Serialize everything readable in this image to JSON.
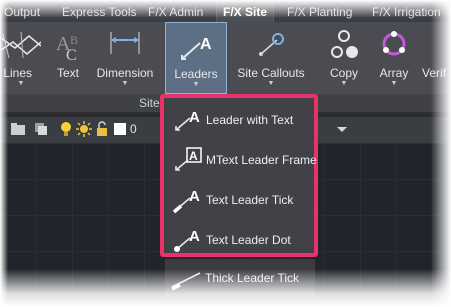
{
  "tabs": [
    "Output",
    "Express Tools",
    "F/X Admin",
    "F/X Site",
    "F/X Planting",
    "F/X Irrigation"
  ],
  "active_tab": "F/X Site",
  "ribbon_buttons": {
    "lines": "Lines",
    "text": "Text",
    "dimension": "Dimension",
    "leaders": "Leaders",
    "site_callouts": "Site Callouts",
    "copy": "Copy",
    "array": "Array",
    "verify": "Verif"
  },
  "panel_label": "Site",
  "toolbar": {
    "layer_value": "0"
  },
  "leaders_menu": {
    "items": [
      "Leader with Text",
      "MText Leader Frame",
      "Text Leader Tick",
      "Text Leader Dot"
    ],
    "extra_item": "Thick Leader Tick"
  },
  "colors": {
    "highlight_border": "#e8326a",
    "accent": "#8fb2d6"
  }
}
